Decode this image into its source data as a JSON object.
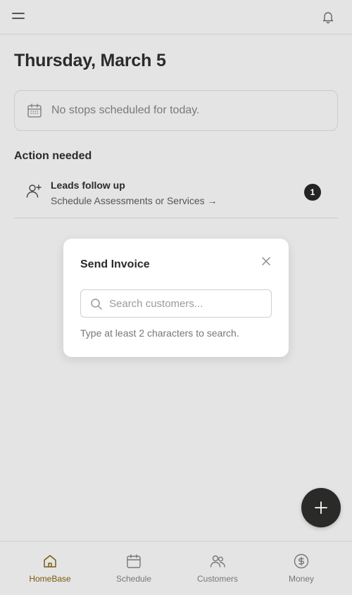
{
  "header": {
    "menu_icon": "hamburger-menu-icon",
    "notification_icon": "bell-icon"
  },
  "page": {
    "title": "Thursday, March 5",
    "stops_card": {
      "icon": "calendar-icon",
      "text": "No stops scheduled for today."
    }
  },
  "action_needed": {
    "title": "Action needed",
    "items": [
      {
        "icon": "user-plus-icon",
        "title": "Leads follow up",
        "subtitle": "Schedule Assessments or Services →",
        "count": "1"
      }
    ]
  },
  "modal": {
    "title": "Send Invoice",
    "close_icon": "close-icon",
    "search": {
      "placeholder": "Search customers...",
      "value": ""
    },
    "hint": "Type at least 2 characters to search."
  },
  "fab": {
    "icon": "plus-icon"
  },
  "bottom_nav": {
    "items": [
      {
        "label": "HomeBase",
        "icon": "home-icon",
        "active": true
      },
      {
        "label": "Schedule",
        "icon": "calendar-icon",
        "active": false
      },
      {
        "label": "Customers",
        "icon": "users-icon",
        "active": false
      },
      {
        "label": "Money",
        "icon": "dollar-circle-icon",
        "active": false
      }
    ]
  },
  "colors": {
    "background": "#e4e4e4",
    "accent": "#7a5a0c",
    "fab": "#2a2a28",
    "badge": "#242424"
  }
}
